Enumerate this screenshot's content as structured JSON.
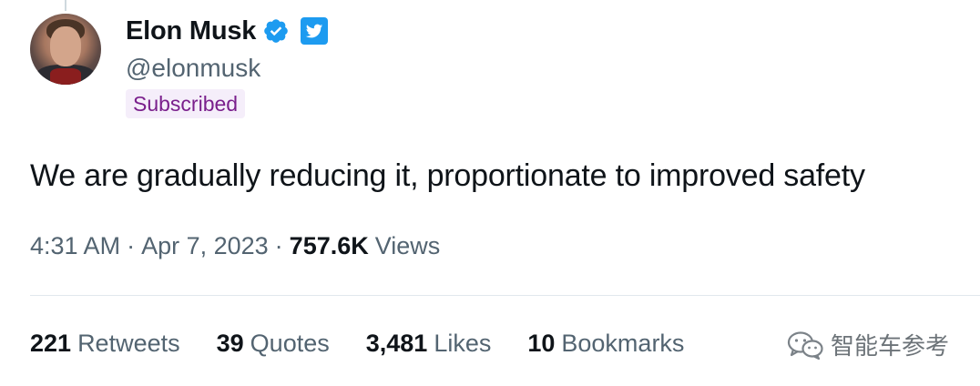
{
  "author": {
    "name": "Elon Musk",
    "handle": "@elonmusk",
    "subscription_label": "Subscribed"
  },
  "tweet": {
    "text": "We are gradually reducing it, proportionate to improved safety",
    "time": "4:31 AM",
    "date": "Apr 7, 2023",
    "views_count": "757.6K",
    "views_label": "Views",
    "separator": "·"
  },
  "stats": [
    {
      "count": "221",
      "label": "Retweets"
    },
    {
      "count": "39",
      "label": "Quotes"
    },
    {
      "count": "3,481",
      "label": "Likes"
    },
    {
      "count": "10",
      "label": "Bookmarks"
    }
  ],
  "watermark": {
    "text": "智能车参考",
    "icon": "wechat-icon"
  },
  "colors": {
    "verified": "#1d9bf0",
    "subscribed_bg": "#f5eefa",
    "subscribed_text": "#7a1f8c",
    "secondary_text": "#536471",
    "primary_text": "#0f1419"
  }
}
